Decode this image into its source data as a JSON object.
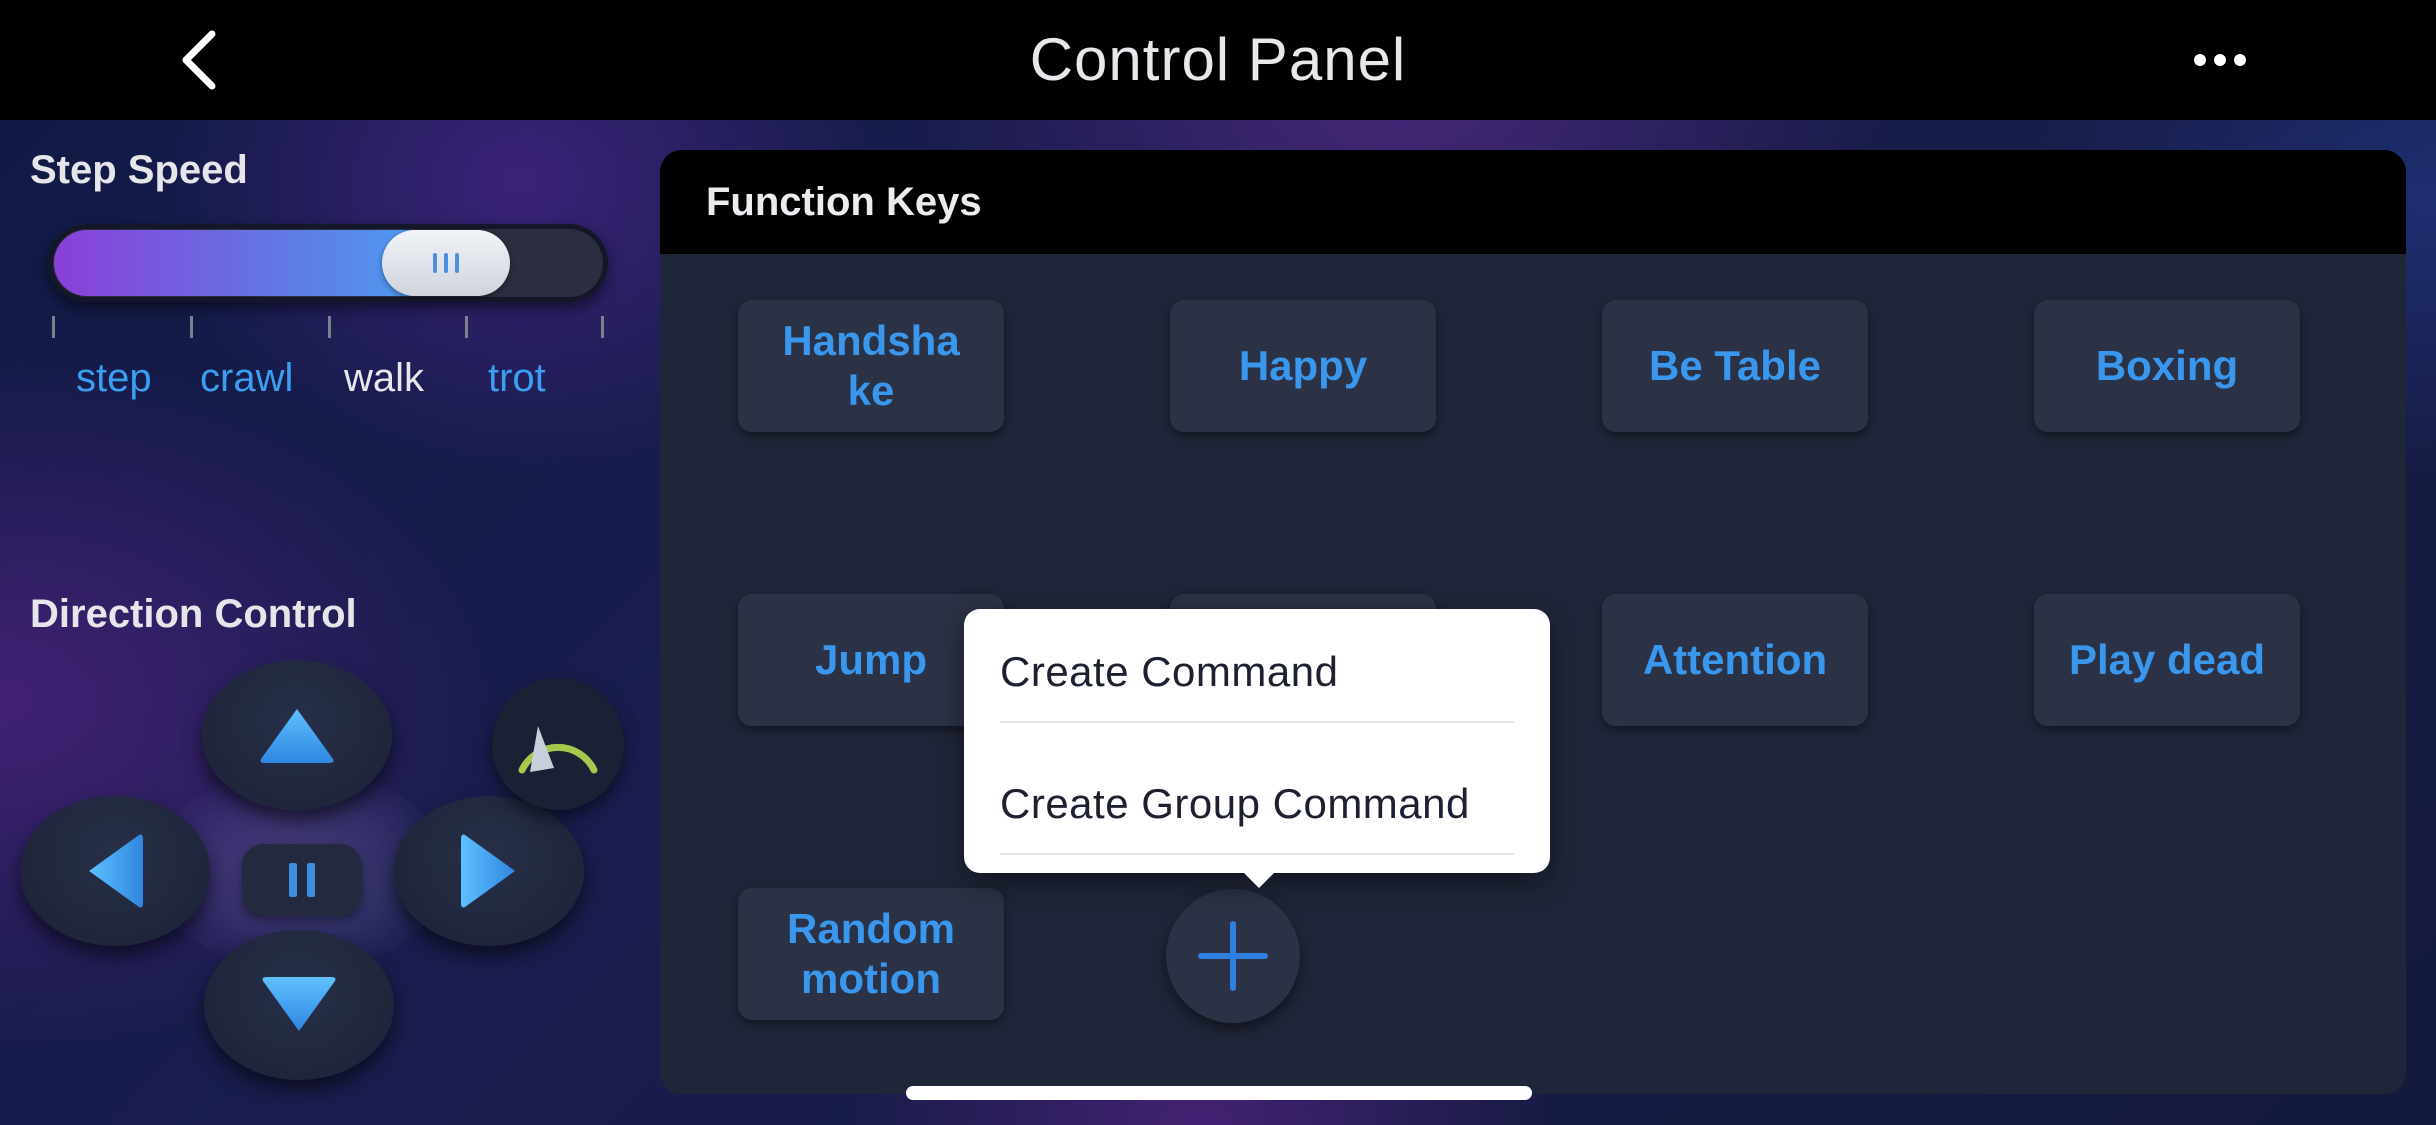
{
  "header": {
    "title": "Control Panel",
    "back_icon": "chevron-left-icon",
    "more_icon": "ellipsis-icon"
  },
  "step_speed": {
    "label": "Step Speed",
    "options": [
      "step",
      "crawl",
      "walk",
      "trot"
    ],
    "selected": "walk",
    "accent_color": "#3a9ff0"
  },
  "direction_control": {
    "label": "Direction Control",
    "buttons": [
      "up-arrow-icon",
      "left-arrow-icon",
      "pause-icon",
      "right-arrow-icon",
      "down-arrow-icon",
      "speedometer-icon"
    ]
  },
  "function_keys": {
    "title": "Function Keys",
    "keys": [
      {
        "label": "Handsha\nke"
      },
      {
        "label": "Happy"
      },
      {
        "label": "Be Table"
      },
      {
        "label": "Boxing"
      },
      {
        "label": "Jump"
      },
      {
        "label": ""
      },
      {
        "label": "Attention"
      },
      {
        "label": "Play dead"
      },
      {
        "label": "Random\nmotion"
      }
    ],
    "add_icon": "plus-icon",
    "key_text_color": "#3a97ee"
  },
  "popover": {
    "items": [
      {
        "label": "Create Command"
      },
      {
        "label": "Create Group Command"
      }
    ]
  }
}
